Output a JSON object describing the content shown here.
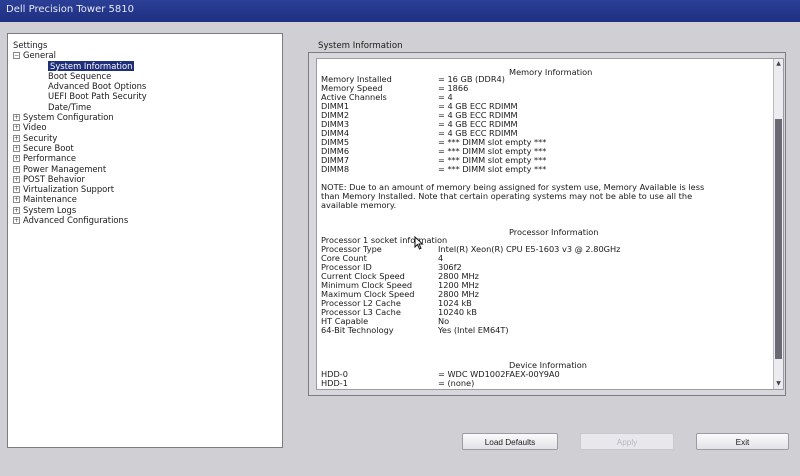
{
  "window": {
    "title": "Dell Precision Tower 5810"
  },
  "settings": {
    "title": "Settings",
    "tree": [
      {
        "label": "General",
        "expanded": true,
        "children": [
          "System Information",
          "Boot Sequence",
          "Advanced Boot Options",
          "UEFI Boot Path Security",
          "Date/Time"
        ]
      },
      {
        "label": "System Configuration"
      },
      {
        "label": "Video"
      },
      {
        "label": "Security"
      },
      {
        "label": "Secure Boot"
      },
      {
        "label": "Performance"
      },
      {
        "label": "Power Management"
      },
      {
        "label": "POST Behavior"
      },
      {
        "label": "Virtualization Support"
      },
      {
        "label": "Maintenance"
      },
      {
        "label": "System Logs"
      },
      {
        "label": "Advanced Configurations"
      }
    ],
    "selected": "System Information"
  },
  "panel": {
    "title": "System Information",
    "memory": {
      "heading": "Memory Information",
      "rows": [
        {
          "label": "Memory Installed",
          "value": "= 16 GB (DDR4)"
        },
        {
          "label": "Memory Speed",
          "value": "= 1866"
        },
        {
          "label": "Active Channels",
          "value": "= 4"
        },
        {
          "label": "DIMM1",
          "value": "= 4 GB ECC RDIMM"
        },
        {
          "label": "DIMM2",
          "value": "= 4 GB ECC RDIMM"
        },
        {
          "label": "DIMM3",
          "value": "= 4 GB ECC RDIMM"
        },
        {
          "label": "DIMM4",
          "value": "= 4 GB ECC RDIMM"
        },
        {
          "label": "DIMM5",
          "value": "= *** DIMM slot empty ***"
        },
        {
          "label": "DIMM6",
          "value": "= *** DIMM slot empty ***"
        },
        {
          "label": "DIMM7",
          "value": "= *** DIMM slot empty ***"
        },
        {
          "label": "DIMM8",
          "value": "= *** DIMM slot empty ***"
        }
      ],
      "note_lines": [
        "NOTE: Due to an amount of memory being assigned for system use, Memory Available is less",
        "than Memory Installed. Note that certain operating systems may not be able to use all the",
        "available memory."
      ]
    },
    "processor": {
      "heading": "Processor Information",
      "rows": [
        {
          "label": "Processor 1 socket information",
          "value": ""
        },
        {
          "label": "Processor Type",
          "value": "Intel(R) Xeon(R) CPU E5-1603 v3 @ 2.80GHz"
        },
        {
          "label": "Core Count",
          "value": "4"
        },
        {
          "label": "Processor ID",
          "value": "306f2"
        },
        {
          "label": "Current Clock Speed",
          "value": "2800 MHz"
        },
        {
          "label": "Minimum Clock Speed",
          "value": "1200 MHz"
        },
        {
          "label": "Maximum Clock Speed",
          "value": "2800 MHz"
        },
        {
          "label": "Processor L2 Cache",
          "value": "1024 kB"
        },
        {
          "label": "Processor L3 Cache",
          "value": "10240 kB"
        },
        {
          "label": "HT Capable",
          "value": "No"
        },
        {
          "label": "64-Bit Technology",
          "value": "Yes (Intel EM64T)"
        }
      ]
    },
    "device": {
      "heading": "Device Information",
      "rows": [
        {
          "label": "HDD-0",
          "value": "= WDC WD1002FAEX-00Y9A0"
        },
        {
          "label": "HDD-1",
          "value": "= (none)"
        }
      ]
    }
  },
  "buttons": {
    "load_defaults": "Load Defaults",
    "apply": "Apply",
    "exit": "Exit"
  },
  "icons": {
    "cursor": "mouse-pointer-icon"
  }
}
